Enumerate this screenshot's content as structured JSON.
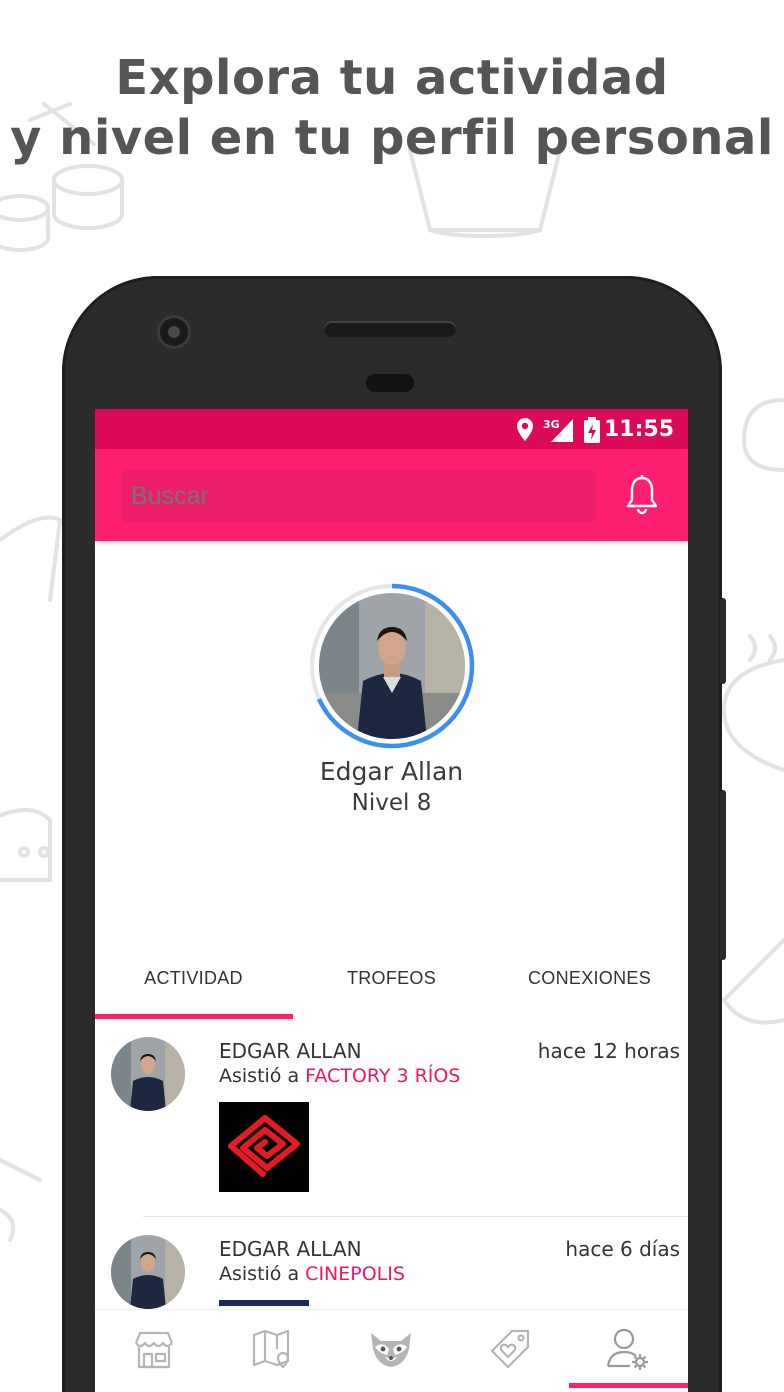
{
  "headline": {
    "line1": "Explora tu actividad",
    "line2": "y nivel en tu perfil personal"
  },
  "status_bar": {
    "network": "3G",
    "time": "11:55",
    "icons": [
      "location-icon",
      "signal-icon",
      "battery-charging-icon"
    ]
  },
  "app_bar": {
    "search_placeholder": "Buscar",
    "notifications_icon": "bell-icon"
  },
  "profile": {
    "name": "Edgar Allan",
    "level": "Nivel 8"
  },
  "tabs": [
    {
      "label": "ACTIVIDAD",
      "active": true
    },
    {
      "label": "TROFEOS",
      "active": false
    },
    {
      "label": "CONEXIONES",
      "active": false
    }
  ],
  "feed": [
    {
      "user": "EDGAR ALLAN",
      "time": "hace 12 horas",
      "action": "Asistió a",
      "place": "FACTORY 3 RÍOS"
    },
    {
      "user": "EDGAR ALLAN",
      "time": "hace 6 días",
      "action": "Asistió a",
      "place": "CINEPOLIS"
    }
  ],
  "bottom_nav": [
    {
      "icon": "store-icon",
      "active": false
    },
    {
      "icon": "map-icon",
      "active": false
    },
    {
      "icon": "raccoon-icon",
      "active": false
    },
    {
      "icon": "tag-heart-icon",
      "active": false
    },
    {
      "icon": "user-settings-icon",
      "active": true
    }
  ],
  "colors": {
    "accent": "#ff1f71",
    "status_bar": "#dc0b5a",
    "link": "#f0156b",
    "level_ring": "#3d8ef0"
  }
}
